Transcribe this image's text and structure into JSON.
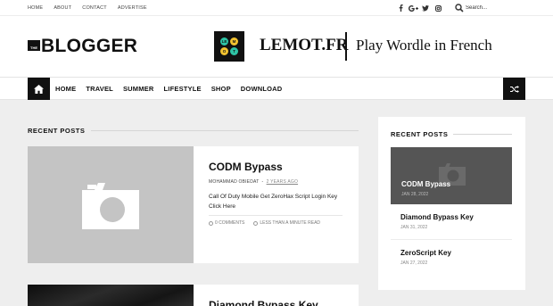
{
  "topbar": {
    "links": [
      "HOME",
      "ABOUT",
      "CONTACT",
      "ADVERTISE"
    ],
    "social_icons": [
      "facebook-icon",
      "google-plus-icon",
      "twitter-icon",
      "instagram-icon"
    ],
    "search_placeholder": "Search..."
  },
  "header": {
    "logo_small": "THE",
    "logo_text": "BLOGGER",
    "ad": {
      "logo_letters": [
        "LE",
        "M",
        "O",
        "T"
      ],
      "logo_colors": [
        "#2ec4a6",
        "#f2c230",
        "#f2c230",
        "#2ec4a6"
      ],
      "brand": "LEMOT.FR",
      "tagline": "Play Wordle in French"
    }
  },
  "nav": {
    "items": [
      "HOME",
      "TRAVEL",
      "SUMMER",
      "LIFESTYLE",
      "SHOP",
      "DOWNLOAD"
    ],
    "home_icon": "home-icon",
    "shuffle_icon": "shuffle-icon"
  },
  "main": {
    "section_title": "RECENT POSTS",
    "posts": [
      {
        "title": "CODM Bypass",
        "author": "MOHAMMAD OBIEDAT",
        "ago": "2 YEARS AGO",
        "excerpt": "Call Of Duty Mobile  Get ZeroHax Script  Login Key Click Here",
        "comments": "0 COMMENTS",
        "read_time": "LESS THAN A MINUTE  READ"
      },
      {
        "title": "Diamond Bypass Key"
      }
    ]
  },
  "sidebar": {
    "section_title": "RECENT POSTS",
    "featured": {
      "title": "CODM Bypass",
      "date": "JAN 28, 2022"
    },
    "items": [
      {
        "title": "Diamond Bypass Key",
        "date": "JAN 31, 2022"
      },
      {
        "title": "ZeroScript Key",
        "date": "JAN 27, 2022"
      }
    ]
  },
  "colors": {
    "accent": "#111111",
    "background": "#eeeeee",
    "thumb": "#c4c4c4"
  }
}
